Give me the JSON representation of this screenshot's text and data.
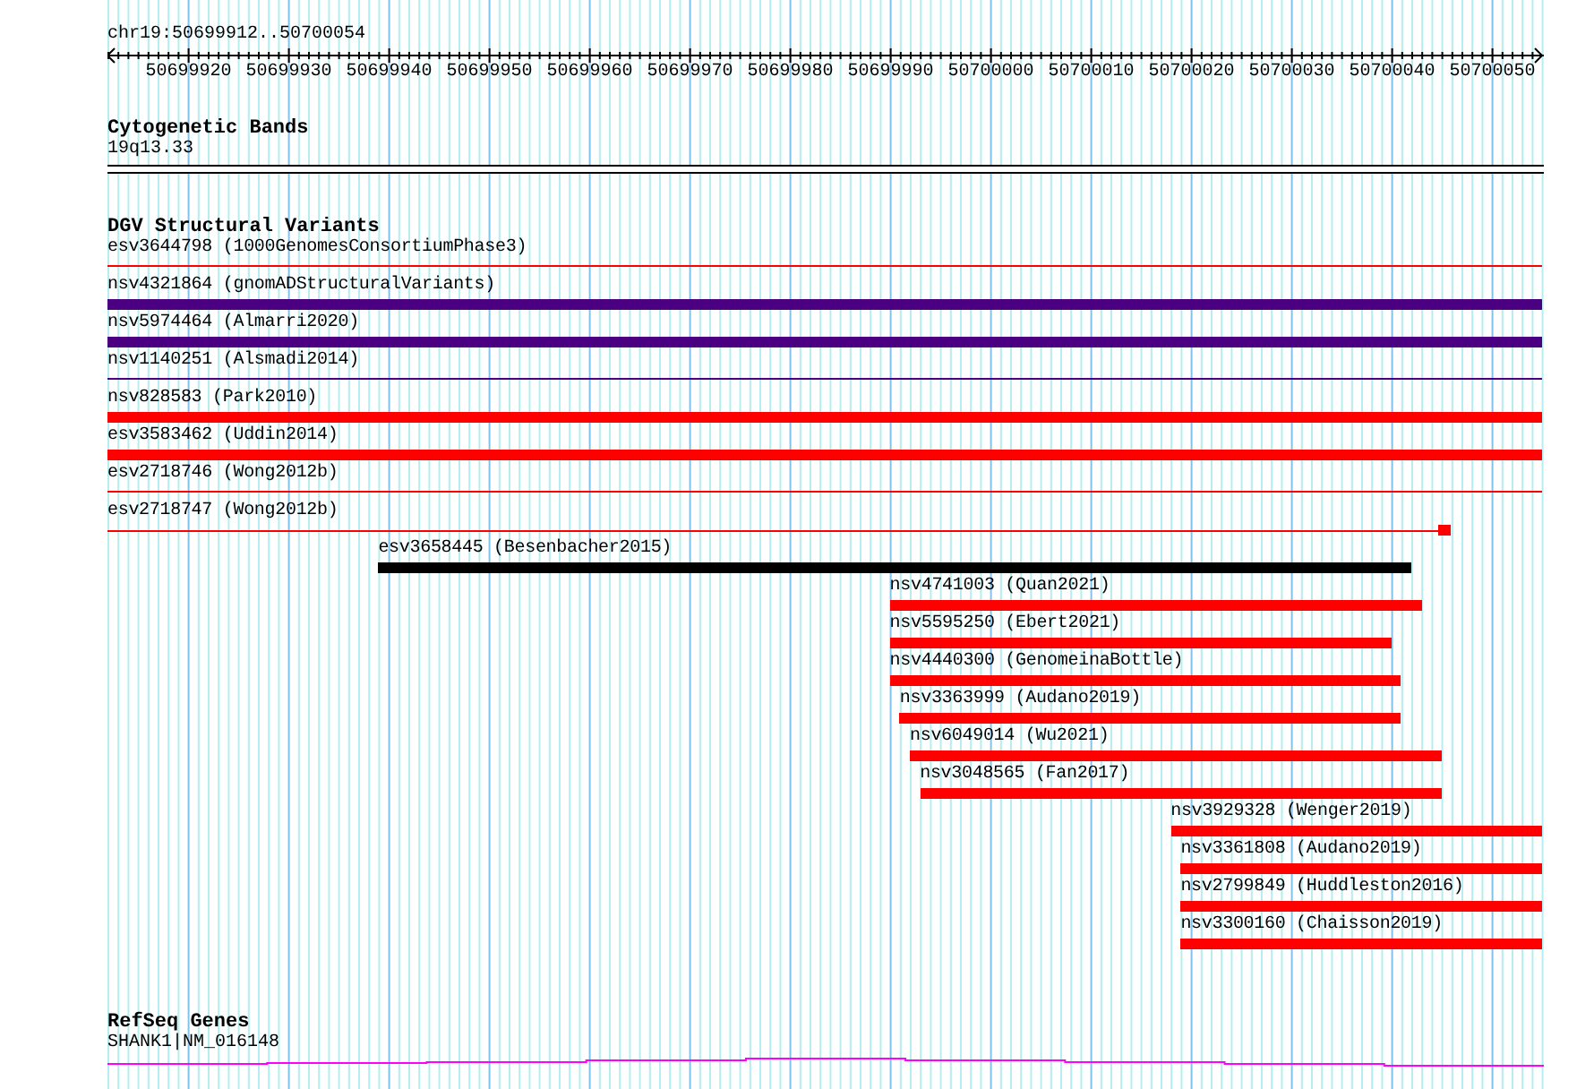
{
  "view": {
    "location": "chr19:50699912..50700054"
  },
  "ruler": {
    "ticks": [
      "50699920",
      "50699930",
      "50699940",
      "50699950",
      "50699960",
      "50699970",
      "50699980",
      "50699990",
      "50700000",
      "50700010",
      "50700020",
      "50700030",
      "50700040",
      "50700050"
    ]
  },
  "tracks": [
    {
      "kind": "bands",
      "title": "Cytogenetic Bands",
      "features": [
        {
          "label": "19q13.33"
        }
      ]
    },
    {
      "kind": "variants",
      "title": "DGV Structural Variants",
      "features": [
        {
          "label": "esv3644798 (1000GenomesConsortiumPhase3)",
          "kind": "line",
          "color": "#ff0000"
        },
        {
          "label": "nsv4321864 (gnomADStructuralVariants)",
          "kind": "bar",
          "color": "#4b0082"
        },
        {
          "label": "nsv5974464 (Almarri2020)",
          "kind": "bar",
          "color": "#4b0082"
        },
        {
          "label": "nsv1140251 (Alsmadi2014)",
          "kind": "line",
          "color": "#4b0082"
        },
        {
          "label": "nsv828583 (Park2010)",
          "kind": "bar",
          "color": "#ff0000"
        },
        {
          "label": "esv3583462 (Uddin2014)",
          "kind": "bar",
          "color": "#ff0000"
        },
        {
          "label": "esv2718746 (Wong2012b)",
          "kind": "line",
          "color": "#ff0000"
        },
        {
          "label": "esv2718747 (Wong2012b)",
          "kind": "capped",
          "color": "#ff0000"
        },
        {
          "label": "esv3658445 (Besenbacher2015)",
          "kind": "bar",
          "color": "#000000"
        },
        {
          "label": "nsv4741003 (Quan2021)",
          "kind": "bar",
          "color": "#ff0000"
        },
        {
          "label": "nsv5595250 (Ebert2021)",
          "kind": "bar",
          "color": "#ff0000"
        },
        {
          "label": "nsv4440300 (GenomeinaBottle)",
          "kind": "bar",
          "color": "#ff0000"
        },
        {
          "label": "nsv3363999 (Audano2019)",
          "kind": "bar",
          "color": "#ff0000"
        },
        {
          "label": "nsv6049014 (Wu2021)",
          "kind": "bar",
          "color": "#ff0000"
        },
        {
          "label": "nsv3048565 (Fan2017)",
          "kind": "bar",
          "color": "#ff0000"
        },
        {
          "label": "nsv3929328 (Wenger2019)",
          "kind": "bar",
          "color": "#ff0000"
        },
        {
          "label": "nsv3361808 (Audano2019)",
          "kind": "bar",
          "color": "#ff0000"
        },
        {
          "label": "nsv2799849 (Huddleston2016)",
          "kind": "bar",
          "color": "#ff0000"
        },
        {
          "label": "nsv3300160 (Chaisson2019)",
          "kind": "bar",
          "color": "#ff0000"
        }
      ]
    },
    {
      "kind": "genes",
      "title": "RefSeq Genes",
      "features": [
        {
          "label": "SHANK1|NM_016148"
        }
      ]
    }
  ]
}
